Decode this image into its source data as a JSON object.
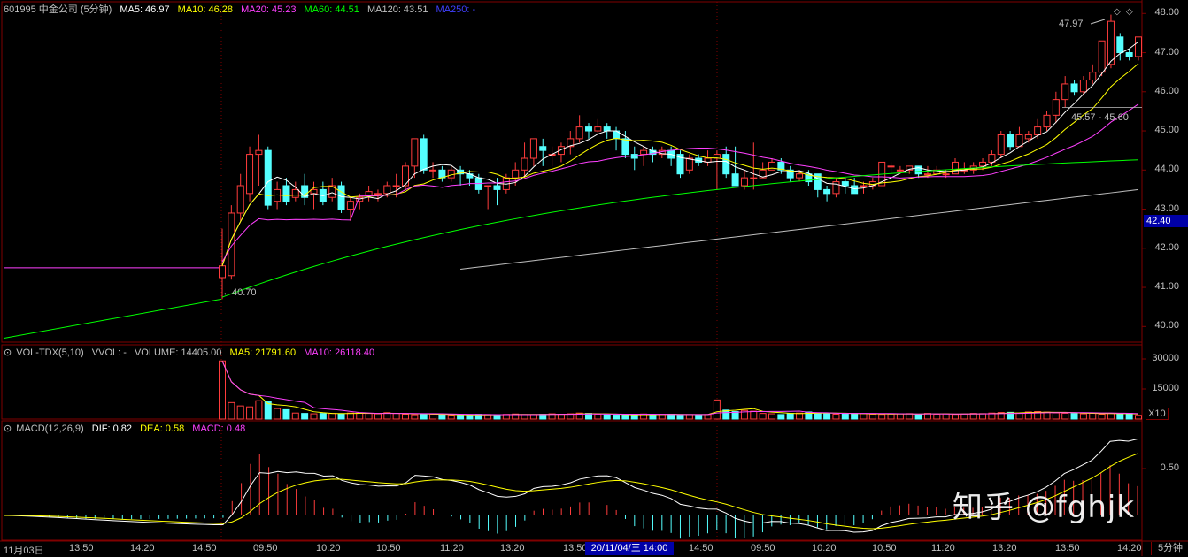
{
  "header": {
    "code_name": "601995 中金公司 (5分钟)",
    "ma5": "MA5: 46.97",
    "ma10": "MA10: 46.28",
    "ma20": "MA20: 45.23",
    "ma60": "MA60: 44.51",
    "ma120": "MA120: 43.51",
    "ma250": "MA250: -"
  },
  "vol_header": {
    "name": "VOL-TDX(5,10)",
    "vvol": "VVOL: -",
    "volume": "VOLUME: 14405.00",
    "ma5": "MA5: 21791.60",
    "ma10": "MA10: 26118.40"
  },
  "macd_header": {
    "name": "MACD(12,26,9)",
    "dif": "DIF: 0.82",
    "dea": "DEA: 0.58",
    "macd": "MACD: 0.48"
  },
  "price_axis": [
    "48.00",
    "47.00",
    "46.00",
    "45.00",
    "44.00",
    "43.00",
    "42.00",
    "41.00",
    "40.00"
  ],
  "current_price_tag": "42.40",
  "vol_axis": [
    "30000",
    "15000"
  ],
  "vol_multiplier": "X10",
  "macd_axis": [
    "0.50"
  ],
  "x_labels": [
    "11月03日",
    "13:50",
    "14:20",
    "14:50",
    "09:50",
    "10:20",
    "10:50",
    "11:20",
    "13:20",
    "13:50",
    "14:50",
    "09:50",
    "10:20",
    "10:50",
    "11:20",
    "13:20",
    "13:50",
    "14:20"
  ],
  "date_tag": "20/11/04/三 14:00",
  "period_tag": "5分钟",
  "annotations": {
    "high": "47.97",
    "low": "←40.70",
    "ref": "45.57 - 45.60"
  },
  "watermark": "知乎 @fghjk",
  "colors": {
    "up": "#ff3c3c",
    "down": "#54ffff",
    "ma5": "#ffffff",
    "ma10": "#ffff00",
    "ma20": "#ff40ff",
    "ma60": "#00ff00",
    "ma120": "#c0c0c0",
    "ma250": "#4040ff",
    "grid": "#800000"
  },
  "chart_data": {
    "type": "candlestick",
    "ylim": [
      39.6,
      48.3
    ],
    "candles": [
      [
        41.25,
        41.55,
        40.7,
        42.5
      ],
      [
        41.3,
        42.9,
        41.2,
        43.1
      ],
      [
        42.9,
        43.6,
        42.7,
        43.9
      ],
      [
        43.4,
        44.4,
        43.2,
        44.6
      ],
      [
        44.4,
        44.5,
        43.6,
        44.9
      ],
      [
        44.5,
        43.1,
        43.0,
        44.6
      ],
      [
        43.2,
        43.5,
        43.0,
        43.7
      ],
      [
        43.6,
        43.2,
        43.1,
        43.8
      ],
      [
        43.3,
        43.5,
        43.2,
        43.7
      ],
      [
        43.6,
        43.3,
        43.1,
        43.9
      ],
      [
        43.4,
        43.5,
        43.0,
        43.7
      ],
      [
        43.5,
        43.2,
        43.1,
        43.7
      ],
      [
        43.3,
        43.6,
        43.2,
        43.8
      ],
      [
        43.6,
        43.0,
        42.9,
        43.7
      ],
      [
        43.0,
        43.2,
        42.7,
        43.3
      ],
      [
        43.2,
        43.3,
        43.0,
        43.4
      ],
      [
        43.35,
        43.45,
        43.2,
        43.6
      ],
      [
        43.4,
        43.4,
        43.2,
        43.5
      ],
      [
        43.4,
        43.6,
        43.3,
        43.7
      ],
      [
        43.6,
        43.6,
        43.3,
        43.9
      ],
      [
        43.6,
        44.1,
        43.5,
        44.2
      ],
      [
        44.1,
        44.8,
        43.8,
        44.8
      ],
      [
        44.8,
        44.0,
        43.9,
        44.9
      ],
      [
        44.0,
        44.0,
        43.8,
        44.2
      ],
      [
        44.0,
        43.8,
        43.7,
        44.1
      ],
      [
        43.8,
        44.0,
        43.7,
        44.1
      ],
      [
        44.0,
        43.9,
        43.6,
        44.1
      ],
      [
        43.9,
        43.8,
        43.6,
        44.0
      ],
      [
        43.8,
        43.5,
        43.4,
        43.9
      ],
      [
        43.6,
        43.6,
        43.0,
        43.6
      ],
      [
        43.6,
        43.5,
        43.1,
        43.8
      ],
      [
        43.5,
        43.8,
        43.4,
        43.9
      ],
      [
        43.8,
        44.0,
        43.6,
        44.2
      ],
      [
        44.0,
        44.3,
        43.8,
        44.7
      ],
      [
        44.3,
        44.8,
        44.1,
        44.8
      ],
      [
        44.6,
        44.5,
        44.1,
        44.8
      ],
      [
        44.4,
        44.4,
        44.1,
        44.6
      ],
      [
        44.4,
        44.6,
        44.2,
        44.7
      ],
      [
        44.6,
        44.8,
        44.4,
        45.0
      ],
      [
        44.8,
        45.1,
        44.7,
        45.4
      ],
      [
        45.1,
        45.0,
        44.8,
        45.2
      ],
      [
        45.0,
        45.1,
        44.9,
        45.3
      ],
      [
        45.1,
        45.0,
        44.8,
        45.2
      ],
      [
        45.0,
        44.8,
        44.5,
        45.1
      ],
      [
        44.8,
        44.4,
        44.3,
        45.0
      ],
      [
        44.4,
        44.3,
        44.0,
        44.6
      ],
      [
        44.4,
        44.5,
        44.1,
        44.6
      ],
      [
        44.5,
        44.4,
        44.2,
        44.6
      ],
      [
        44.4,
        44.5,
        44.3,
        44.6
      ],
      [
        44.5,
        44.3,
        44.1,
        44.6
      ],
      [
        44.4,
        43.9,
        43.8,
        44.5
      ],
      [
        44.0,
        44.3,
        43.9,
        44.4
      ],
      [
        44.3,
        44.2,
        44.1,
        44.4
      ],
      [
        44.2,
        44.3,
        44.1,
        44.5
      ],
      [
        44.3,
        44.4,
        43.5,
        44.5
      ],
      [
        44.4,
        43.9,
        43.8,
        44.6
      ],
      [
        43.9,
        43.6,
        43.6,
        44.6
      ],
      [
        43.6,
        43.8,
        43.5,
        44.0
      ],
      [
        43.8,
        43.8,
        43.5,
        44.7
      ],
      [
        43.8,
        44.0,
        43.8,
        44.2
      ],
      [
        44.0,
        44.2,
        44.0,
        44.3
      ],
      [
        44.2,
        44.0,
        43.9,
        44.3
      ],
      [
        44.0,
        43.8,
        43.7,
        44.1
      ],
      [
        43.8,
        43.9,
        43.7,
        44.0
      ],
      [
        43.9,
        43.7,
        43.6,
        44.0
      ],
      [
        43.9,
        43.5,
        43.3,
        43.9
      ],
      [
        43.5,
        43.4,
        43.2,
        43.6
      ],
      [
        43.4,
        43.7,
        43.3,
        43.8
      ],
      [
        43.7,
        43.6,
        43.4,
        43.8
      ],
      [
        43.6,
        43.4,
        43.4,
        43.8
      ],
      [
        43.6,
        43.6,
        43.4,
        43.7
      ],
      [
        43.6,
        43.7,
        43.5,
        43.8
      ],
      [
        43.6,
        44.2,
        43.6,
        44.2
      ],
      [
        44.1,
        44.1,
        43.9,
        44.2
      ],
      [
        44.0,
        44.0,
        43.9,
        44.1
      ],
      [
        44.0,
        44.1,
        43.9,
        44.1
      ],
      [
        44.1,
        43.9,
        43.8,
        44.1
      ],
      [
        43.9,
        43.9,
        43.8,
        44.1
      ],
      [
        43.9,
        44.0,
        43.9,
        44.1
      ],
      [
        43.9,
        43.9,
        43.8,
        44.0
      ],
      [
        43.9,
        44.2,
        43.9,
        44.3
      ],
      [
        44.0,
        44.0,
        43.9,
        44.2
      ],
      [
        44.0,
        44.1,
        43.9,
        44.2
      ],
      [
        44.1,
        44.2,
        44.0,
        44.3
      ],
      [
        44.2,
        44.4,
        44.1,
        44.5
      ],
      [
        44.4,
        44.9,
        44.3,
        45.0
      ],
      [
        44.9,
        44.6,
        44.5,
        45.0
      ],
      [
        44.6,
        44.9,
        44.6,
        45.1
      ],
      [
        44.8,
        44.9,
        44.7,
        45.0
      ],
      [
        44.9,
        45.1,
        44.8,
        45.3
      ],
      [
        45.1,
        45.4,
        45.0,
        45.5
      ],
      [
        45.4,
        45.8,
        45.2,
        46.0
      ],
      [
        45.8,
        46.2,
        45.6,
        46.4
      ],
      [
        46.2,
        46.0,
        45.9,
        46.3
      ],
      [
        46.0,
        46.3,
        45.9,
        46.4
      ],
      [
        46.3,
        46.5,
        46.2,
        46.7
      ],
      [
        46.5,
        47.3,
        46.4,
        47.3
      ],
      [
        46.7,
        47.8,
        46.6,
        47.97
      ],
      [
        47.4,
        47.0,
        46.8,
        47.5
      ],
      [
        47.0,
        46.9,
        46.8,
        47.1
      ],
      [
        46.9,
        47.4,
        46.8,
        47.4
      ]
    ],
    "volumes": [
      3100,
      880,
      700,
      650,
      980,
      920,
      560,
      500,
      320,
      300,
      280,
      300,
      300,
      280,
      320,
      320,
      300,
      280,
      340,
      300,
      260,
      230,
      280,
      260,
      240,
      210,
      200,
      220,
      250,
      240,
      230,
      250,
      270,
      240,
      240,
      250,
      280,
      260,
      280,
      320,
      300,
      260,
      230,
      210,
      220,
      240,
      270,
      240,
      250,
      260,
      230,
      240,
      230,
      240,
      1020,
      480,
      400,
      460,
      420,
      300,
      280,
      240,
      300,
      320,
      380,
      320,
      310,
      260,
      280,
      300,
      290,
      260,
      250,
      270,
      280,
      290,
      250,
      300,
      260,
      280,
      250,
      270,
      300,
      290,
      320,
      350,
      360,
      320,
      380,
      400,
      370,
      330,
      310,
      300,
      280,
      320,
      260,
      300,
      280,
      300,
      200
    ]
  }
}
